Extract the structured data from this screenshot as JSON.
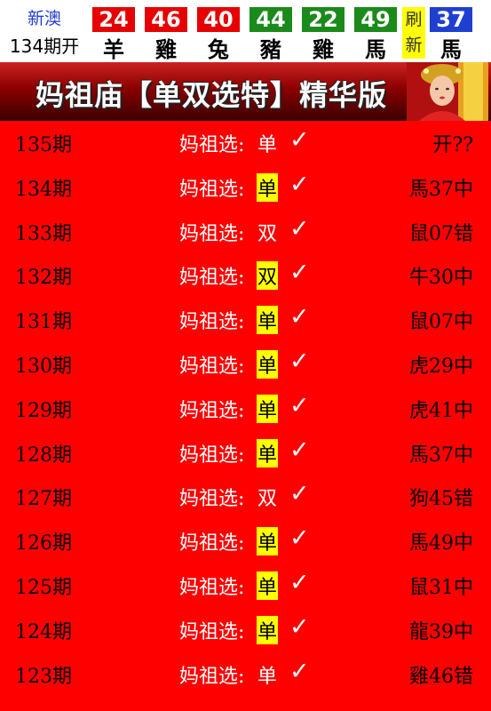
{
  "header": {
    "region": "新澳",
    "issue": "134期开",
    "balls": [
      {
        "num": "24",
        "zodiac": "羊",
        "color": "#e60000"
      },
      {
        "num": "46",
        "zodiac": "雞",
        "color": "#e60000"
      },
      {
        "num": "40",
        "zodiac": "兔",
        "color": "#e60000"
      },
      {
        "num": "44",
        "zodiac": "豬",
        "color": "#1a8a1a"
      },
      {
        "num": "22",
        "zodiac": "雞",
        "color": "#1a8a1a"
      },
      {
        "num": "49",
        "zodiac": "馬",
        "color": "#1a8a1a"
      }
    ],
    "refresh": [
      "刷",
      "新"
    ],
    "special": {
      "num": "37",
      "zodiac": "馬",
      "color": "#1f3fd1"
    }
  },
  "banner": {
    "title": "妈祖庙【单双选特】精华版"
  },
  "rows": [
    {
      "period": "135期",
      "label": "妈祖选:",
      "pick": "单",
      "highlight": false,
      "result": "开??"
    },
    {
      "period": "134期",
      "label": "妈祖选:",
      "pick": "单",
      "highlight": true,
      "result": "馬37中"
    },
    {
      "period": "133期",
      "label": "妈祖选:",
      "pick": "双",
      "highlight": false,
      "result": "鼠07错"
    },
    {
      "period": "132期",
      "label": "妈祖选:",
      "pick": "双",
      "highlight": true,
      "result": "牛30中"
    },
    {
      "period": "131期",
      "label": "妈祖选:",
      "pick": "单",
      "highlight": true,
      "result": "鼠07中"
    },
    {
      "period": "130期",
      "label": "妈祖选:",
      "pick": "单",
      "highlight": true,
      "result": "虎29中"
    },
    {
      "period": "129期",
      "label": "妈祖选:",
      "pick": "单",
      "highlight": true,
      "result": "虎41中"
    },
    {
      "period": "128期",
      "label": "妈祖选:",
      "pick": "单",
      "highlight": true,
      "result": "馬37中"
    },
    {
      "period": "127期",
      "label": "妈祖选:",
      "pick": "双",
      "highlight": false,
      "result": "狗45错"
    },
    {
      "period": "126期",
      "label": "妈祖选:",
      "pick": "单",
      "highlight": true,
      "result": "馬49中"
    },
    {
      "period": "125期",
      "label": "妈祖选:",
      "pick": "单",
      "highlight": true,
      "result": "鼠31中"
    },
    {
      "period": "124期",
      "label": "妈祖选:",
      "pick": "单",
      "highlight": true,
      "result": "龍39中"
    },
    {
      "period": "123期",
      "label": "妈祖选:",
      "pick": "单",
      "highlight": false,
      "result": "雞46错"
    }
  ]
}
